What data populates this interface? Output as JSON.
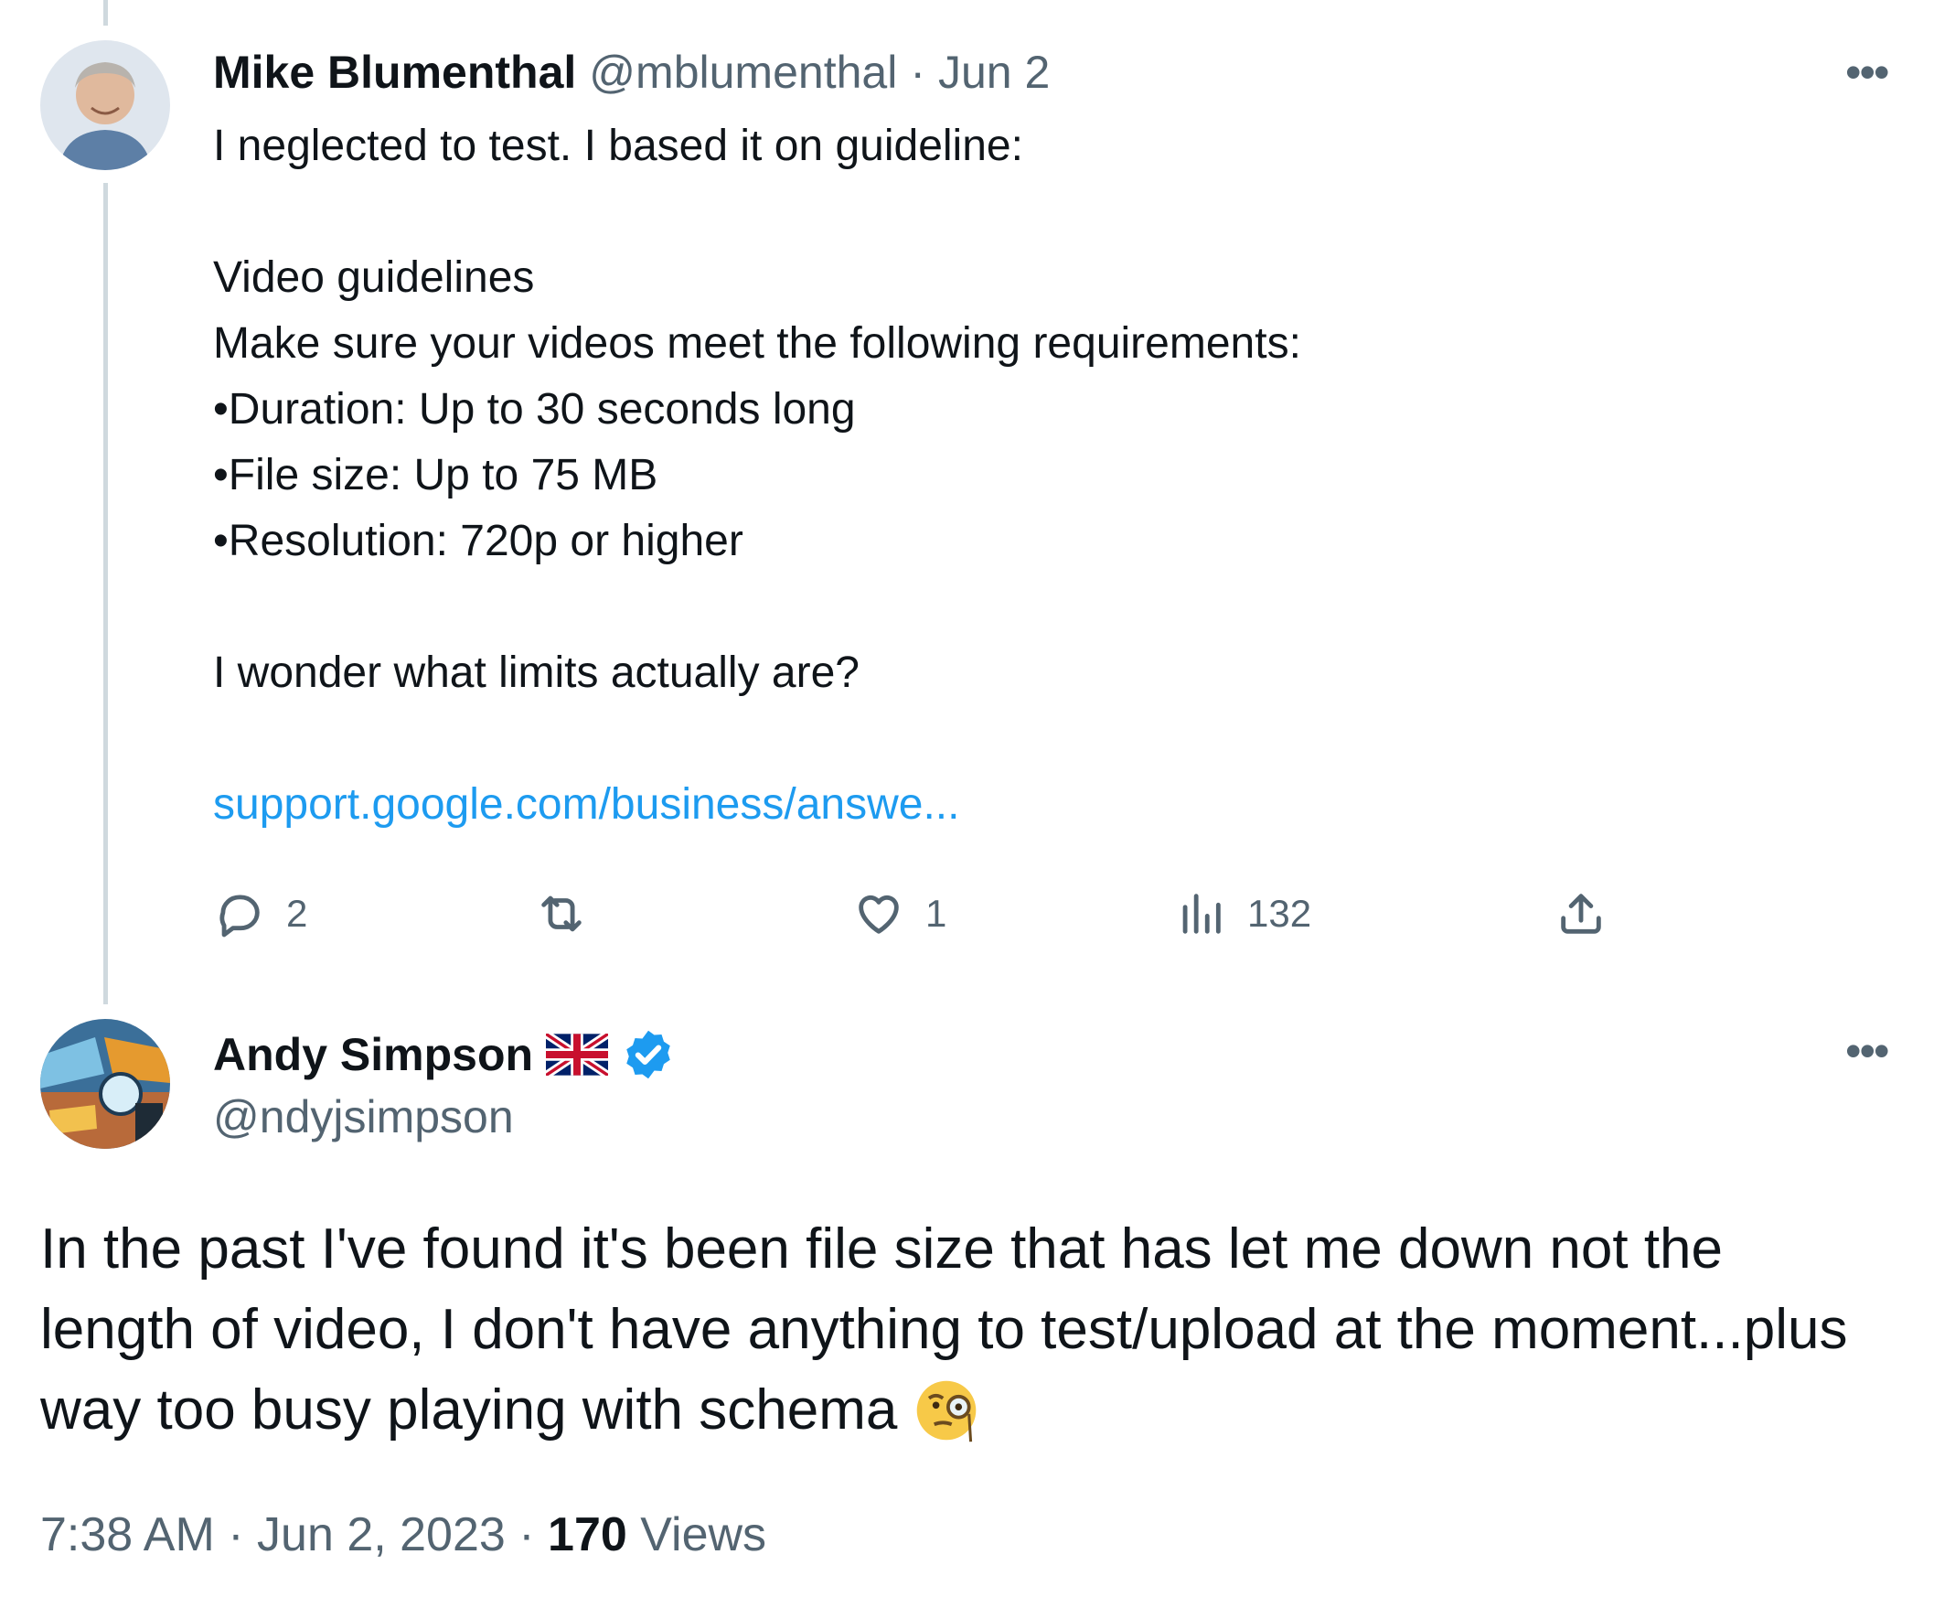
{
  "tweet1": {
    "name": "Mike Blumenthal",
    "handle": "@mblumenthal",
    "separator": "·",
    "date": "Jun 2",
    "more_label": "•••",
    "lines": [
      "I neglected to test. I based it on guideline:",
      "",
      "Video guidelines",
      "Make sure your videos meet the following requirements:",
      "•Duration: Up to 30 seconds long",
      "•File size: Up to 75 MB",
      "•Resolution: 720p or higher",
      "",
      "I wonder what limits actually are?"
    ],
    "link": "support.google.com/business/answe...",
    "replies": "2",
    "retweets": "",
    "likes": "1",
    "views": "132"
  },
  "tweet2": {
    "name": "Andy Simpson",
    "flag_icon": "uk-flag-icon",
    "verified_icon": "verified-badge-icon",
    "handle": "@ndyjsimpson",
    "more_label": "•••",
    "lines": [
      "In the past I've found it's been file size that has let me down not the",
      "length of video, I don't have anything to test/upload at the moment...plus",
      "way too busy playing with schema"
    ],
    "emoji_icon": "face-with-monocle-icon",
    "time": "7:38 AM",
    "sep1": "·",
    "date": "Jun 2, 2023",
    "sep2": "·",
    "views_count": "170",
    "views_label": "Views"
  },
  "colors": {
    "text": "#0f1419",
    "secondary": "#536471",
    "link": "#1d9bf0",
    "verified": "#1d9bf0",
    "thread_line": "#cfd9de"
  }
}
